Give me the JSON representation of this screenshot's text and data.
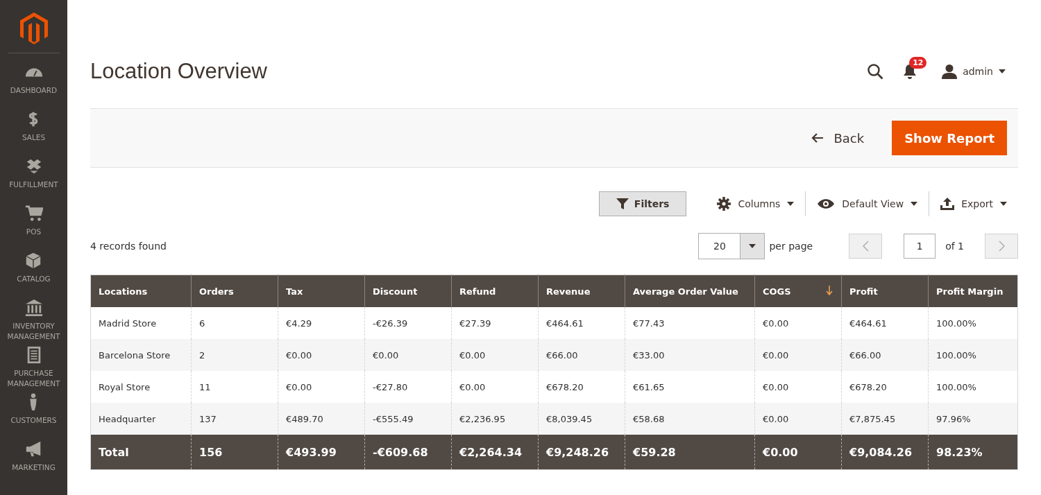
{
  "sidebar": {
    "items": [
      {
        "label": "DASHBOARD"
      },
      {
        "label": "SALES"
      },
      {
        "label": "FULFILLMENT"
      },
      {
        "label": "POS"
      },
      {
        "label": "CATALOG"
      },
      {
        "label": "INVENTORY MANAGEMENT"
      },
      {
        "label": "PURCHASE MANAGEMENT"
      },
      {
        "label": "CUSTOMERS"
      },
      {
        "label": "MARKETING"
      }
    ]
  },
  "header": {
    "title": "Location Overview",
    "notifications": "12",
    "user": "admin"
  },
  "actions": {
    "back": "Back",
    "primary": "Show Report"
  },
  "toolbar": {
    "filters": "Filters",
    "columns": "Columns",
    "view": "Default View",
    "export": "Export"
  },
  "records": "4 records found",
  "pager": {
    "per_page_value": "20",
    "per_page_label": "per page",
    "page": "1",
    "of": "of 1"
  },
  "table": {
    "columns": [
      {
        "label": "Locations",
        "sorted": false
      },
      {
        "label": "Orders",
        "sorted": false
      },
      {
        "label": "Tax",
        "sorted": false
      },
      {
        "label": "Discount",
        "sorted": false
      },
      {
        "label": "Refund",
        "sorted": false
      },
      {
        "label": "Revenue",
        "sorted": false
      },
      {
        "label": "Average Order Value",
        "sorted": false
      },
      {
        "label": "COGS",
        "sorted": true
      },
      {
        "label": "Profit",
        "sorted": false
      },
      {
        "label": "Profit Margin",
        "sorted": false
      }
    ],
    "rows": [
      [
        "Madrid Store",
        "6",
        "€4.29",
        "-€26.39",
        "€27.39",
        "€464.61",
        "€77.43",
        "€0.00",
        "€464.61",
        "100.00%"
      ],
      [
        "Barcelona Store",
        "2",
        "€0.00",
        "€0.00",
        "€0.00",
        "€66.00",
        "€33.00",
        "€0.00",
        "€66.00",
        "100.00%"
      ],
      [
        "Royal Store",
        "11",
        "€0.00",
        "-€27.80",
        "€0.00",
        "€678.20",
        "€61.65",
        "€0.00",
        "€678.20",
        "100.00%"
      ],
      [
        "Headquarter",
        "137",
        "€489.70",
        "-€555.49",
        "€2,236.95",
        "€8,039.45",
        "€58.68",
        "€0.00",
        "€7,875.45",
        "97.96%"
      ]
    ],
    "total": [
      "Total",
      "156",
      "€493.99",
      "-€609.68",
      "€2,264.34",
      "€9,248.26",
      "€59.28",
      "€0.00",
      "€9,084.26",
      "98.23%"
    ]
  }
}
